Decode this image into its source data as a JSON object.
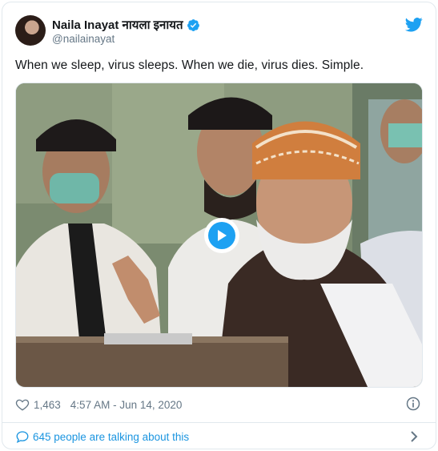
{
  "user": {
    "display_name": "Naila Inayat नायला इनायत",
    "handle": "@nailainayat",
    "verified": true
  },
  "tweet": {
    "text": "When we sleep, virus sleeps. When we die, virus dies. Simple."
  },
  "media": {
    "kind": "video",
    "play_icon": "play-icon"
  },
  "meta": {
    "likes": "1,463",
    "timestamp": "4:57 AM - Jun 14, 2020"
  },
  "conversation": {
    "label": "645 people are talking about this"
  },
  "colors": {
    "accent": "#1da1f2",
    "link": "#1b95e0",
    "muted": "#657786",
    "border": "#e1e8ed"
  }
}
